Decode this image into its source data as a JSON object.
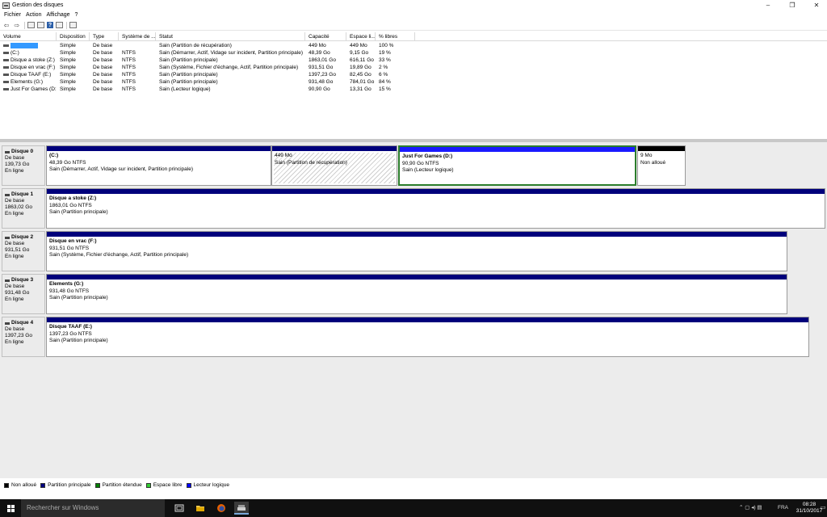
{
  "window": {
    "title": "Gestion des disques",
    "min_glyph": "–",
    "max_glyph": "❐",
    "close_glyph": "✕"
  },
  "menu": [
    "Fichier",
    "Action",
    "Affichage",
    "?"
  ],
  "toolbar_icons": [
    "back-arrow-icon",
    "forward-arrow-icon",
    "list-view-icon",
    "properties-icon",
    "help-icon",
    "grid-view-icon",
    "panel-icon"
  ],
  "toolbar_glyphs": {
    "back": "⇦",
    "forward": "⇨",
    "help": "?"
  },
  "volume_table": {
    "headers": [
      "Volume",
      "Disposition",
      "Type",
      "Système de ...",
      "Statut",
      "Capacité",
      "Espace li...",
      "% libres"
    ],
    "rows": [
      {
        "volume": "",
        "selected": true,
        "disposition": "Simple",
        "type": "De base",
        "fs": "",
        "status": "Sain (Partition de récupération)",
        "capacity": "449 Mo",
        "free": "449 Mo",
        "pct": "100 %"
      },
      {
        "volume": "(C:)",
        "selected": false,
        "disposition": "Simple",
        "type": "De base",
        "fs": "NTFS",
        "status": "Sain (Démarrer, Actif, Vidage sur incident, Partition principale)",
        "capacity": "48,39 Go",
        "free": "9,15 Go",
        "pct": "19 %"
      },
      {
        "volume": "Disque a stoke (Z:)",
        "selected": false,
        "disposition": "Simple",
        "type": "De base",
        "fs": "NTFS",
        "status": "Sain (Partition principale)",
        "capacity": "1863,01 Go",
        "free": "616,11 Go",
        "pct": "33 %"
      },
      {
        "volume": "Disque en vrac (F:)",
        "selected": false,
        "disposition": "Simple",
        "type": "De base",
        "fs": "NTFS",
        "status": "Sain (Système, Fichier d'échange, Actif, Partition principale)",
        "capacity": "931,51 Go",
        "free": "19,89 Go",
        "pct": "2 %"
      },
      {
        "volume": "Disque TAAF (E:)",
        "selected": false,
        "disposition": "Simple",
        "type": "De base",
        "fs": "NTFS",
        "status": "Sain (Partition principale)",
        "capacity": "1397,23 Go",
        "free": "82,45 Go",
        "pct": "6 %"
      },
      {
        "volume": "Elements (G:)",
        "selected": false,
        "disposition": "Simple",
        "type": "De base",
        "fs": "NTFS",
        "status": "Sain (Partition principale)",
        "capacity": "931,48 Go",
        "free": "784,01 Go",
        "pct": "84 %"
      },
      {
        "volume": "Just For Games (D:)",
        "selected": false,
        "disposition": "Simple",
        "type": "De base",
        "fs": "NTFS",
        "status": "Sain (Lecteur logique)",
        "capacity": "90,90 Go",
        "free": "13,31 Go",
        "pct": "15 %"
      }
    ]
  },
  "disks": [
    {
      "name": "Disque 0",
      "type": "De base",
      "size": "139,73 Go",
      "state": "En ligne",
      "partitions": [
        {
          "label": "(C:)",
          "size": "48,39 Go NTFS",
          "status": "Sain (Démarrer, Actif, Vidage sur incident, Partition principale)",
          "kind": "primary"
        },
        {
          "label": "",
          "size": "449 Mo",
          "status": "Sain (Partition de récupération)",
          "kind": "recovery"
        },
        {
          "label": "Just For Games  (D:)",
          "size": "90,90 Go NTFS",
          "status": "Sain (Lecteur logique)",
          "kind": "logical"
        },
        {
          "label": "",
          "size": "9 Mo",
          "status": "Non alloué",
          "kind": "unallocated"
        }
      ]
    },
    {
      "name": "Disque 1",
      "type": "De base",
      "size": "1863,02 Go",
      "state": "En ligne",
      "partitions": [
        {
          "label": "Disque a stoke  (Z:)",
          "size": "1863,01 Go NTFS",
          "status": "Sain (Partition principale)",
          "kind": "primary"
        }
      ]
    },
    {
      "name": "Disque 2",
      "type": "De base",
      "size": "931,51 Go",
      "state": "En ligne",
      "partitions": [
        {
          "label": "Disque en vrac  (F:)",
          "size": "931,51 Go NTFS",
          "status": "Sain (Système, Fichier d'échange, Actif, Partition principale)",
          "kind": "primary"
        }
      ]
    },
    {
      "name": "Disque 3",
      "type": "De base",
      "size": "931,48 Go",
      "state": "En ligne",
      "partitions": [
        {
          "label": "Elements  (G:)",
          "size": "931,48 Go NTFS",
          "status": "Sain (Partition principale)",
          "kind": "primary"
        }
      ]
    },
    {
      "name": "Disque 4",
      "type": "De base",
      "size": "1397,23 Go",
      "state": "En ligne",
      "partitions": [
        {
          "label": "Disque TAAF  (E:)",
          "size": "1397,23 Go NTFS",
          "status": "Sain (Partition principale)",
          "kind": "primary"
        }
      ]
    }
  ],
  "legend": [
    {
      "label": "Non alloué",
      "color": "#000000"
    },
    {
      "label": "Partition principale",
      "color": "#000080"
    },
    {
      "label": "Partition étendue",
      "color": "#008000"
    },
    {
      "label": "Espace libre",
      "color": "#33cc33"
    },
    {
      "label": "Lecteur logique",
      "color": "#0000ff"
    }
  ],
  "colors": {
    "primary": "#00007b",
    "logical": "#1a1aff",
    "unallocated": "#000000",
    "recovery": "#00007b",
    "selection": "#2b7d2b"
  },
  "taskbar": {
    "search_placeholder": "Rechercher sur Windows",
    "icons": [
      "task-view-icon",
      "file-explorer-icon",
      "firefox-icon",
      "disk-management-icon"
    ],
    "tray_glyphs": "⌃  ▢  ◂)  ▤",
    "language": "FRA",
    "time": "08:28",
    "date": "31/10/2017",
    "notification_glyph": "▭"
  }
}
